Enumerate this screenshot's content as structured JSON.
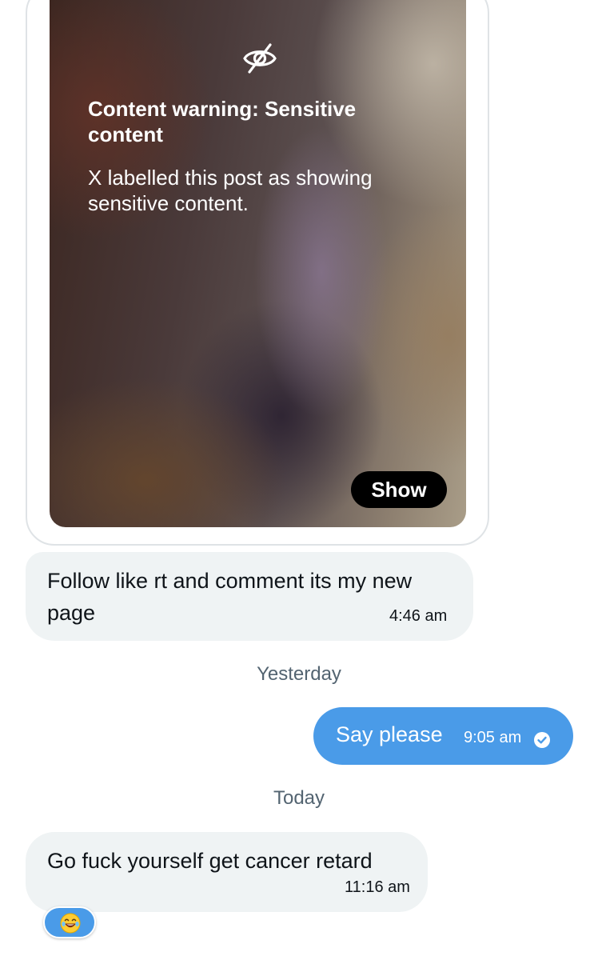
{
  "media": {
    "warning_title": "Content warning: Sensitive content",
    "warning_body": "X labelled this post as showing sensitive content.",
    "show_label": "Show",
    "icon": "eye-slash-icon"
  },
  "messages": [
    {
      "direction": "received",
      "text": "Follow like rt and comment its my new page",
      "time": "4:46 am"
    },
    {
      "direction": "sent",
      "text": "Say please",
      "time": "9:05 am",
      "status_icon": "read-check-icon"
    },
    {
      "direction": "received",
      "text": "Go fuck yourself get cancer retard",
      "time": "11:16 am",
      "reaction": "😂",
      "reaction_icon": "laughing-tears-emoji-icon"
    }
  ],
  "separators": {
    "yesterday": "Yesterday",
    "today": "Today"
  },
  "colors": {
    "sent_bubble": "#4a9be8",
    "received_bubble": "#eff3f4",
    "separator_text": "#536471"
  }
}
